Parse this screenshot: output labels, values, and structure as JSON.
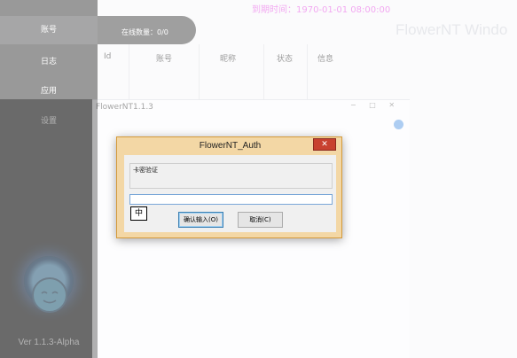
{
  "header": {
    "expire_text": "到期时间：1970-01-01 08:00:00",
    "app_title": "FlowerNT Windo",
    "online_count": "在线数量：0/0"
  },
  "sidebar": {
    "items": [
      {
        "label": "账号",
        "active": true
      },
      {
        "label": "日志",
        "active": false
      },
      {
        "label": "应用",
        "active": false
      },
      {
        "label": "设置",
        "active": false
      }
    ],
    "version": "Ver 1.1.3-Alpha"
  },
  "table": {
    "columns": [
      "Id",
      "账号",
      "昵称",
      "状态",
      "信息"
    ]
  },
  "inner_window": {
    "title": "FlowerNT1.1.3",
    "controls": "− □ ✕"
  },
  "dialog": {
    "title": "FlowerNT_Auth",
    "close": "✕",
    "prompt": "卡密验证",
    "input_value": "",
    "ime_indicator": "中",
    "ok_label": "确认输入(O)",
    "cancel_label": "取消(C)"
  },
  "colors": {
    "accent_magenta": "#e23ee0",
    "sidebar_bg": "#1d1d1d",
    "dialog_frame": "#f3d7a5",
    "close_red": "#c8412f"
  }
}
